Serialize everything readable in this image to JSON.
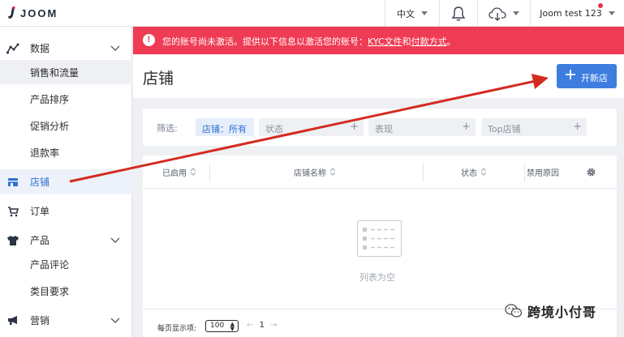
{
  "app": {
    "logo_text": "JOOM"
  },
  "header": {
    "language": "中文",
    "user_name": "Joom test 123"
  },
  "sidebar": {
    "items": [
      {
        "label": "数据",
        "icon": "chart-line-icon"
      },
      {
        "label": "销售和流量"
      },
      {
        "label": "产品排序"
      },
      {
        "label": "促销分析"
      },
      {
        "label": "退款率"
      },
      {
        "label": "店铺",
        "icon": "store-icon"
      },
      {
        "label": "订单",
        "icon": "cart-icon"
      },
      {
        "label": "产品",
        "icon": "tshirt-icon"
      },
      {
        "label": "产品评论"
      },
      {
        "label": "类目要求"
      },
      {
        "label": "营销",
        "icon": "megaphone-icon"
      }
    ]
  },
  "banner": {
    "prefix": "您的账号尚未激活。提供以下信息以激活您的账号：",
    "link1": "KYC文件",
    "middle": "和",
    "link2": "付款方式",
    "suffix": "。",
    "color": "#ef3b53"
  },
  "page": {
    "title": "店铺",
    "new_store_label": "开新店",
    "accent": "#3d7de0"
  },
  "filters": {
    "label": "筛选:",
    "chips": [
      {
        "label": "店铺：所有"
      },
      {
        "label": "状态"
      },
      {
        "label": "表现"
      },
      {
        "label": "Top店铺"
      }
    ]
  },
  "table": {
    "columns": [
      "已启用",
      "店铺名称",
      "状态",
      "禁用原因"
    ],
    "empty_text": "列表为空",
    "per_page_label": "每页显示项:",
    "per_page_value": "100",
    "page": "1"
  },
  "watermark": {
    "text": "跨境小付哥"
  }
}
